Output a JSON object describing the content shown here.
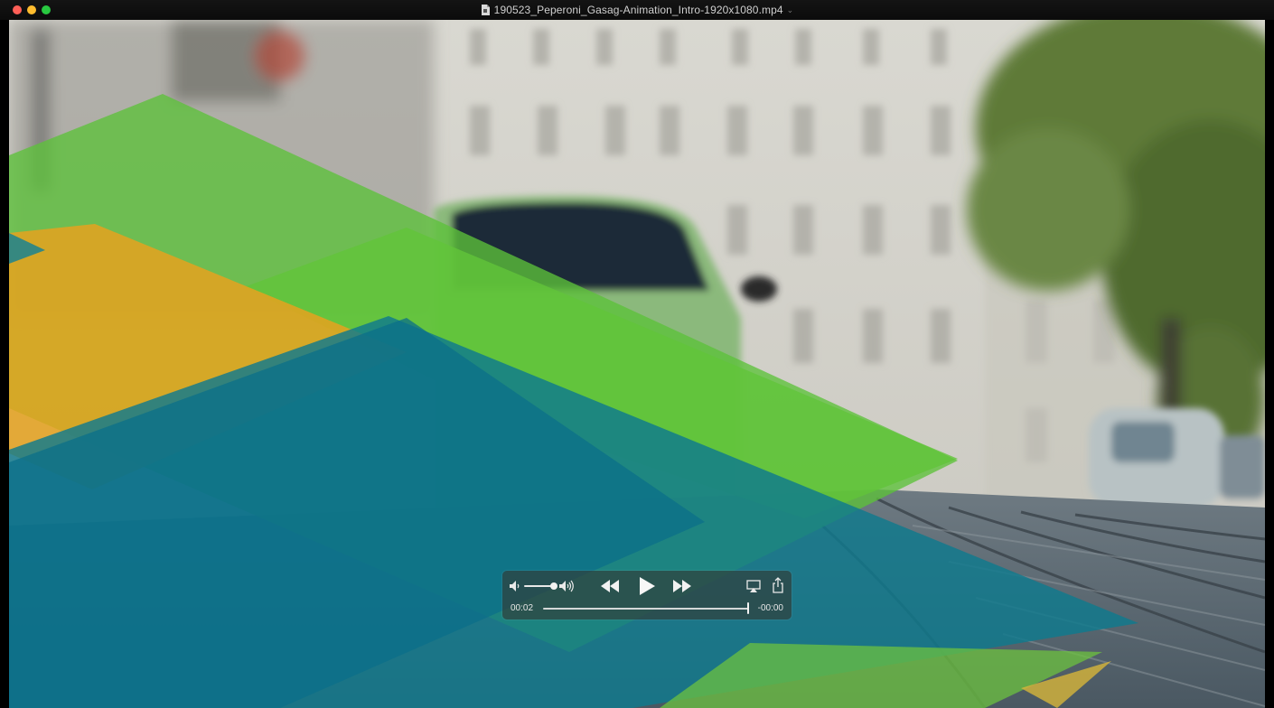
{
  "window": {
    "title": "190523_Peperoni_Gasag-Animation_Intro-1920x1080.mp4"
  },
  "icons": {
    "close": "close-button",
    "minimize": "minimize-button",
    "maximize": "maximize-button",
    "document": "document-icon",
    "volume_low": "speaker-low-icon",
    "volume_high": "speaker-high-icon",
    "rewind": "rewind-icon",
    "play": "play-icon",
    "fast_forward": "fast-forward-icon",
    "airplay": "airplay-icon",
    "share": "share-icon"
  },
  "controls": {
    "current_time": "00:02",
    "remaining_time": "-00:00",
    "volume_fraction": 0.85,
    "playback_fraction": 1.0
  },
  "colors": {
    "traffic_close": "#fe5f57",
    "traffic_min": "#febc2e",
    "traffic_max": "#28c840",
    "green_shape": "#5cc13a",
    "orange_shape": "#e0a023",
    "teal_shape": "#137b8a"
  }
}
